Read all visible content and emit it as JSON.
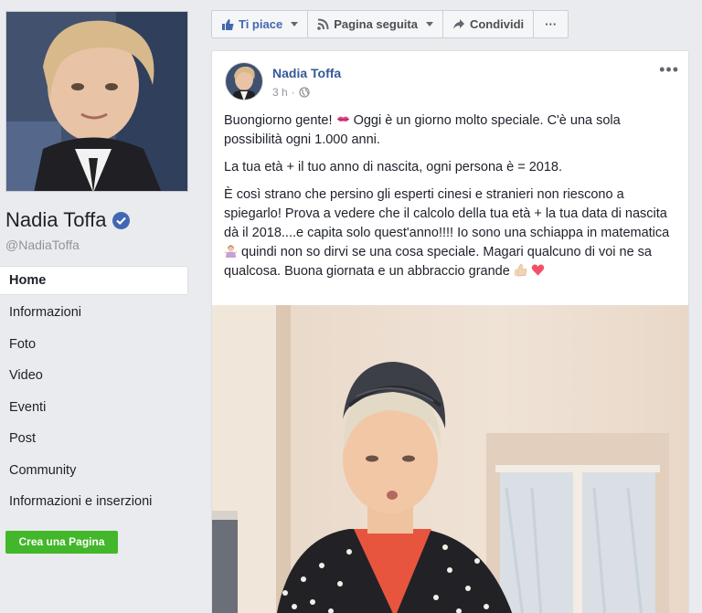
{
  "sidebar": {
    "page_name": "Nadia Toffa",
    "handle": "@NadiaToffa",
    "nav": [
      "Home",
      "Informazioni",
      "Foto",
      "Video",
      "Eventi",
      "Post",
      "Community",
      "Informazioni e inserzioni"
    ],
    "create_button": "Crea una Pagina"
  },
  "actions": {
    "like": "Ti piace",
    "follow": "Pagina seguita",
    "share": "Condividi",
    "more": "···"
  },
  "post": {
    "author": "Nadia Toffa",
    "time": "3 h",
    "separator": "·",
    "more": "•••",
    "p1_a": "Buongiorno gente!",
    "p1_b": "Oggi è un giorno molto speciale. C'è una sola possibilità ogni 1.000 anni.",
    "p2": "La tua età + il tuo anno di nascita, ogni persona è = 2018.",
    "p3_a": "È così strano che persino gli esperti cinesi e stranieri non riescono a spiegarlo! Prova a vedere che il calcolo della tua età + la tua data di nascita dà il 2018....e capita solo quest'anno!!!! Io sono una schiappa in matematica",
    "p3_b": "quindi non so dirvi se una cosa speciale. Magari qualcuno di voi ne sa qualcosa. Buona giornata e un abbraccio grande"
  },
  "colors": {
    "brand_blue": "#4267b2",
    "link_blue": "#365899",
    "green": "#42b72a",
    "background": "#e9ebee"
  },
  "icons": [
    "verified-badge-icon",
    "thumbs-up-icon",
    "rss-icon",
    "share-arrow-icon",
    "globe-icon",
    "kiss-emoji-icon",
    "shrug-emoji-icon",
    "thumbs-up-emoji-icon",
    "heart-emoji-icon"
  ]
}
